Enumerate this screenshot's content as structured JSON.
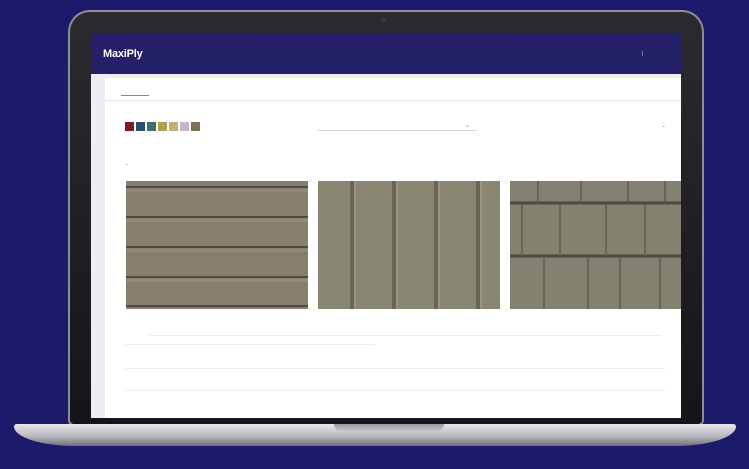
{
  "app": {
    "logo": "MaxiPly",
    "logo_sub": "",
    "header_link_1": "",
    "header_sep": "|",
    "header_link_2": ""
  },
  "tabs": [
    {
      "label": "",
      "active": true
    },
    {
      "label": "",
      "active": false
    },
    {
      "label": "",
      "active": false
    },
    {
      "label": "",
      "active": false
    },
    {
      "label": "",
      "active": false
    },
    {
      "label": "",
      "active": false
    },
    {
      "label": "",
      "active": false
    }
  ],
  "filters": {
    "color_label": "",
    "colors": [
      "#7a1e22",
      "#2c4f6e",
      "#3f6d6f",
      "#b0a14d",
      "#c2b078",
      "#c5b6d0",
      "#7a7253"
    ],
    "select_label": "",
    "select_value": ""
  },
  "filter_link": "",
  "products": [
    {
      "name": "",
      "texture": "lap-siding",
      "color": "#85806e"
    },
    {
      "name": "",
      "texture": "board-batten",
      "color": "#8a8674"
    },
    {
      "name": "",
      "texture": "shake",
      "color": "#858170"
    }
  ],
  "footnote": {
    "line_1": "",
    "line_2": ""
  }
}
